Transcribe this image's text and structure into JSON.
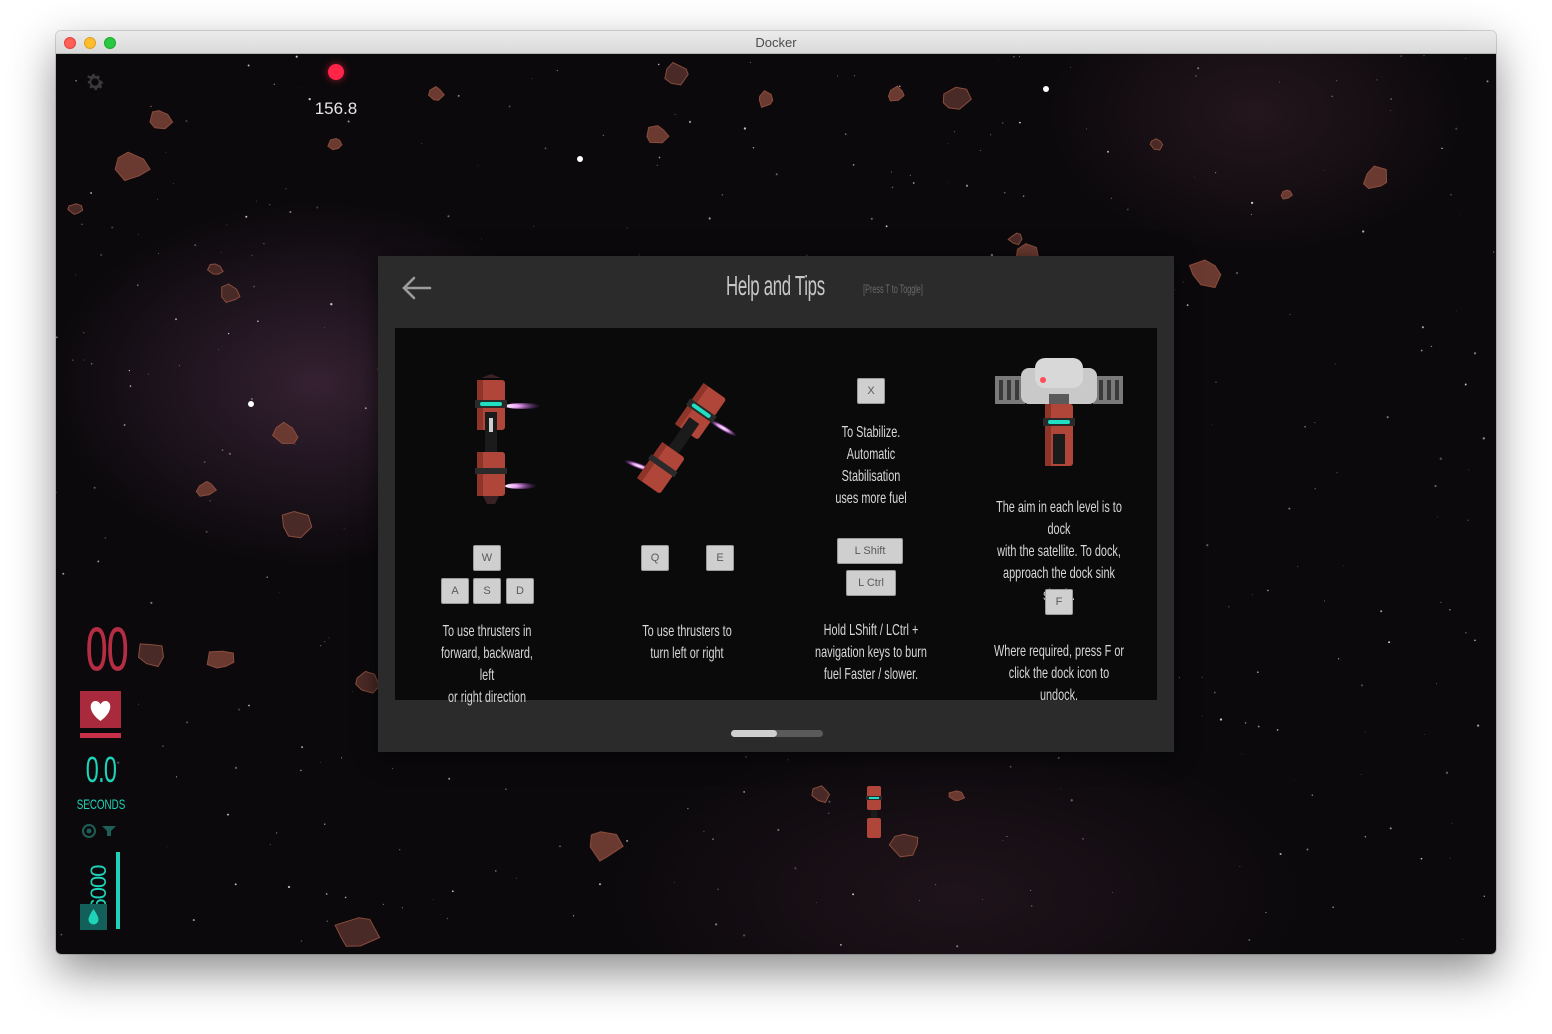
{
  "window": {
    "title": "Docker"
  },
  "hud": {
    "fps": "156.8",
    "lives": "00",
    "time": "0.0",
    "seconds_label": "SECONDS",
    "fuel": "6000",
    "fuel_level": 1.0,
    "colors": {
      "lives": "#b52d43",
      "time": "#1fd3b8",
      "fuel": "#1fd3b8"
    }
  },
  "help": {
    "title": "Help and Tips",
    "hint": "[Press T to Toggle]",
    "pages": {
      "current": 1,
      "total": 2
    },
    "tips": [
      {
        "keys": [
          "W",
          "A",
          "S",
          "D"
        ],
        "text": [
          "To use thrusters in",
          "forward, backward, left",
          "or right direction"
        ]
      },
      {
        "keys": [
          "Q",
          "E"
        ],
        "text": [
          "To use thrusters to",
          "turn left or right"
        ]
      },
      {
        "top_key": "X",
        "top_text": [
          "To Stabilize.",
          "Automatic Stabilisation",
          "uses more fuel"
        ],
        "keys": [
          "L Shift",
          "L Ctrl"
        ],
        "text": [
          "Hold LShift / LCtrl +",
          "navigation keys to burn",
          "fuel Faster / slower."
        ]
      },
      {
        "top_text": [
          "The aim in each level is to dock",
          "with the satellite. To dock,",
          "approach the dock sink slowly."
        ],
        "keys": [
          "F"
        ],
        "text": [
          "Where required, press F or",
          "click the dock icon to undock."
        ]
      }
    ]
  }
}
